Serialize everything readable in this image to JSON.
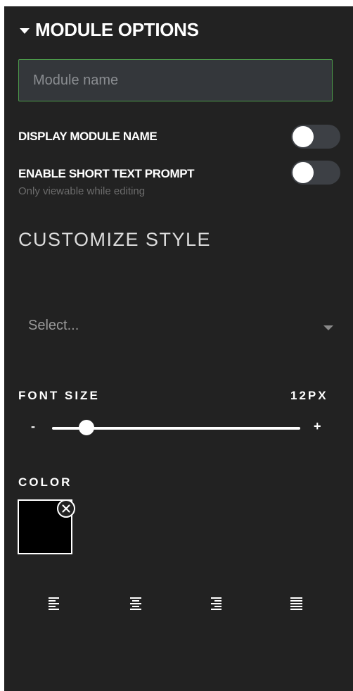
{
  "header": {
    "title": "MODULE OPTIONS",
    "icon": "caret-down-icon"
  },
  "module_name": {
    "value": "",
    "placeholder": "Module name"
  },
  "options": {
    "display_module_name": {
      "label": "DISPLAY MODULE NAME",
      "enabled": false
    },
    "enable_short_text_prompt": {
      "label": "ENABLE SHORT TEXT PROMPT",
      "enabled": false,
      "sublabel": "Only viewable while editing"
    }
  },
  "customize_style": {
    "title": "CUSTOMIZE STYLE",
    "select": {
      "value": "Select..."
    }
  },
  "font_size": {
    "label": "FONT SIZE",
    "value_label": "12PX",
    "minus_label": "-",
    "plus_label": "+",
    "slider_fraction": 0.14
  },
  "color": {
    "label": "COLOR",
    "value": "#000000"
  },
  "alignment": {
    "options": [
      {
        "name": "align-left-icon"
      },
      {
        "name": "align-center-icon"
      },
      {
        "name": "align-right-icon"
      },
      {
        "name": "align-justify-icon"
      }
    ]
  },
  "colors": {
    "panel_bg": "#222222",
    "input_border": "#4c9a4a",
    "toggle_off": "#3d4045"
  }
}
